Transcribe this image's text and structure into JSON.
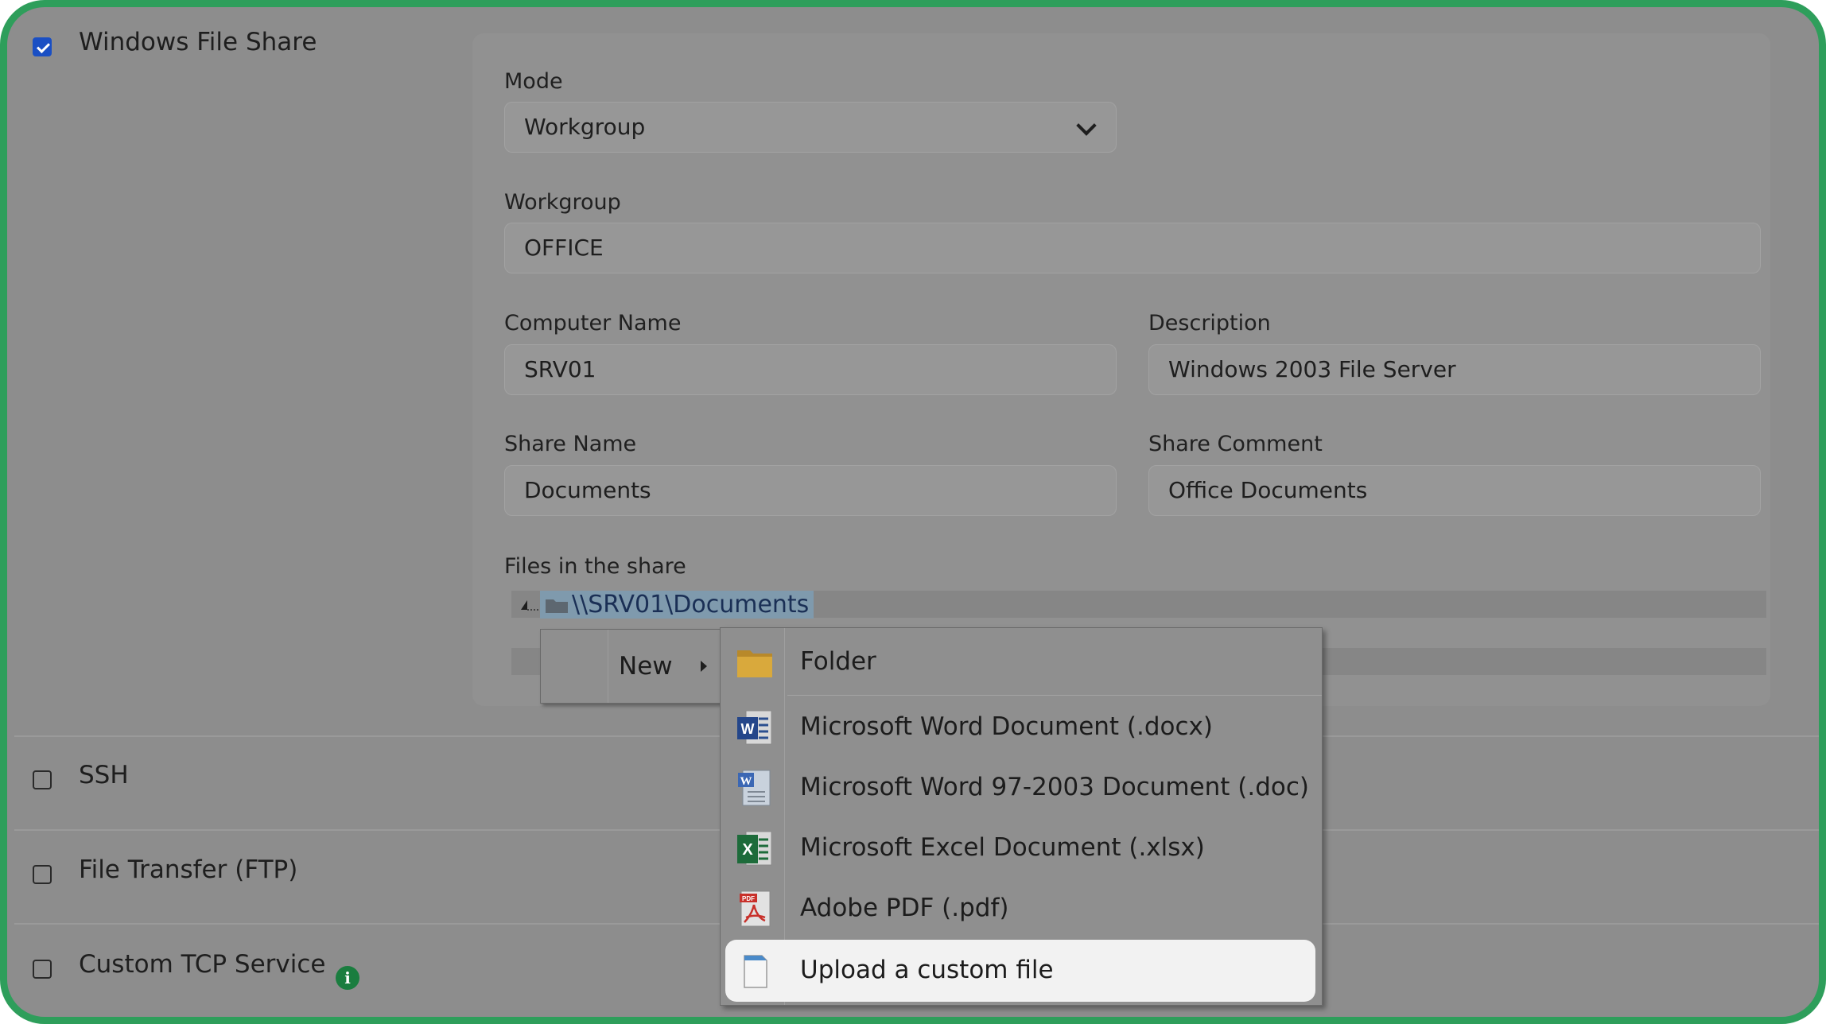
{
  "services": [
    {
      "label": "Windows File Share",
      "checked": true
    },
    {
      "label": "SSH",
      "checked": false
    },
    {
      "label": "File Transfer (FTP)",
      "checked": false
    },
    {
      "label": "Custom TCP Service",
      "checked": false
    }
  ],
  "form": {
    "mode": {
      "label": "Mode",
      "value": "Workgroup"
    },
    "workgroup": {
      "label": "Workgroup",
      "value": "OFFICE"
    },
    "computer_name": {
      "label": "Computer Name",
      "value": "SRV01"
    },
    "description": {
      "label": "Description",
      "value": "Windows 2003 File Server"
    },
    "share_name": {
      "label": "Share Name",
      "value": "Documents"
    },
    "share_comment": {
      "label": "Share Comment",
      "value": "Office Documents"
    },
    "files_label": "Files in the share"
  },
  "tree": {
    "root": "\\\\SRV01\\Documents"
  },
  "context_menu": {
    "new_label": "New",
    "submenu": [
      {
        "label": "Folder",
        "icon": "folder-icon"
      },
      {
        "label": "Microsoft Word Document (.docx)",
        "icon": "word-docx-icon"
      },
      {
        "label": "Microsoft Word 97-2003 Document (.doc)",
        "icon": "word-doc-icon"
      },
      {
        "label": "Microsoft Excel Document (.xlsx)",
        "icon": "excel-icon"
      },
      {
        "label": "Adobe PDF (.pdf)",
        "icon": "pdf-icon"
      },
      {
        "label": "Upload a custom file",
        "icon": "blank-file-icon",
        "highlighted": true
      }
    ]
  },
  "icon_texts": {
    "word": "W",
    "excel": "X",
    "pdf": "PDF",
    "info": "i"
  },
  "colors": {
    "frame": "#2e9e5b",
    "checkbox_on": "#1a4fc4",
    "selection": "#7f9aad",
    "info_badge": "#1a7d3f"
  }
}
